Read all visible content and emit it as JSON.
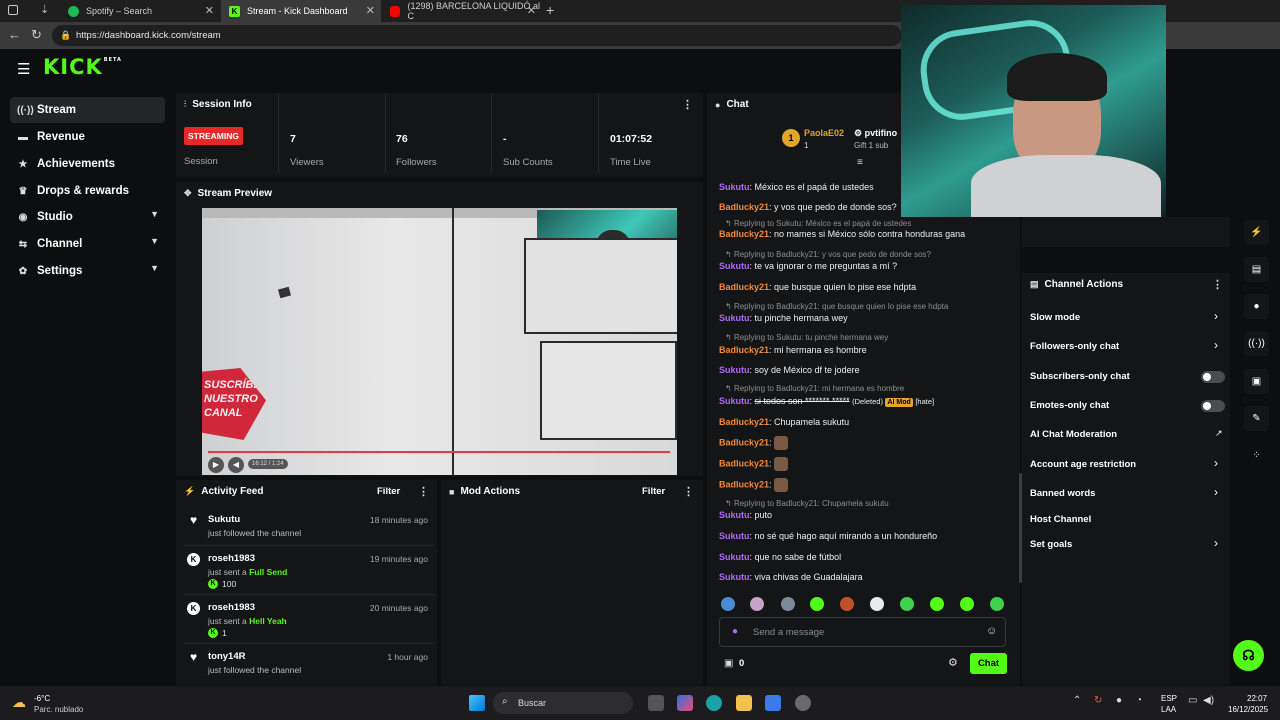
{
  "browser": {
    "tabs": [
      {
        "label": "Spotify – Search",
        "color": "#1db954"
      },
      {
        "label": "Stream - Kick Dashboard",
        "color": "#53fc18"
      },
      {
        "label": "(1298) BARCELONA LIQUIDÓ al C",
        "color": "#ff0000"
      }
    ],
    "url": "https://dashboard.kick.com/stream"
  },
  "logo": {
    "text": "KICK",
    "badge": "BETA"
  },
  "sidebar": {
    "items": [
      {
        "label": "Stream",
        "icon": "broadcast-icon"
      },
      {
        "label": "Revenue",
        "icon": "money-icon"
      },
      {
        "label": "Achievements",
        "icon": "star-icon"
      },
      {
        "label": "Drops & rewards",
        "icon": "gift-icon"
      },
      {
        "label": "Studio",
        "icon": "video-icon"
      },
      {
        "label": "Channel",
        "icon": "user-icon"
      },
      {
        "label": "Settings",
        "icon": "gear-icon"
      }
    ]
  },
  "session": {
    "title": "Session Info",
    "status": "STREAMING",
    "status_label": "Session",
    "stats": [
      {
        "value": "7",
        "label": "Viewers"
      },
      {
        "value": "76",
        "label": "Followers"
      },
      {
        "value": "-",
        "label": "Sub Counts"
      },
      {
        "value": "01:07:52",
        "label": "Time Live"
      }
    ]
  },
  "preview": {
    "title": "Stream Preview",
    "overlay_text": "SUSCRÍBETE NUESTRO CANAL",
    "time": "16:12 / 1:24"
  },
  "activity": {
    "title": "Activity Feed",
    "filter": "Filter",
    "items": [
      {
        "name": "Sukutu",
        "time": "18 minutes ago",
        "desc": "just followed the channel",
        "gift": "",
        "amount": ""
      },
      {
        "name": "roseh1983",
        "time": "19 minutes ago",
        "desc": "just sent a ",
        "gift": "Full Send",
        "amount": "100"
      },
      {
        "name": "roseh1983",
        "time": "20 minutes ago",
        "desc": "just sent a ",
        "gift": "Hell Yeah",
        "amount": "1"
      },
      {
        "name": "tony14R",
        "time": "1 hour ago",
        "desc": "just followed the channel",
        "gift": "",
        "amount": ""
      }
    ]
  },
  "mod_actions": {
    "title": "Mod Actions",
    "filter": "Filter"
  },
  "chat": {
    "title": "Chat",
    "pinned": {
      "user": "PaolaE02",
      "count": "1",
      "other_user": "pvtifino",
      "gift_text": "Gift 1 sub"
    },
    "messages": [
      {
        "reply": "",
        "user": "Sukutu",
        "color": "purple",
        "text": "México es el papá de ustedes"
      },
      {
        "reply": "",
        "user": "Badlucky21",
        "color": "orange",
        "text": "y vos que pedo de donde sos?"
      },
      {
        "reply": "Replying to Sukutu: México es el papá de ustedes",
        "user": "Badlucky21",
        "color": "orange",
        "text": "no mames si México sólo contra honduras gana"
      },
      {
        "reply": "Replying to Badlucky21: y vos que pedo de donde sos?",
        "user": "Sukutu",
        "color": "purple",
        "text": "te va ignorar o me preguntas a mí ?"
      },
      {
        "reply": "",
        "user": "Badlucky21",
        "color": "orange",
        "text": "que busque quien lo pise ese hdpta"
      },
      {
        "reply": "Replying to Badlucky21: que busque quien lo pise ese hdpta",
        "user": "Sukutu",
        "color": "purple",
        "text": "tu pinche hermana wey"
      },
      {
        "reply": "Replying to Sukutu: tu pinche hermana wey",
        "user": "Badlucky21",
        "color": "orange",
        "text": "mi hermana es hombre"
      },
      {
        "reply": "",
        "user": "Sukutu",
        "color": "purple",
        "text": "soy de México df te jodere"
      },
      {
        "reply": "Replying to Badlucky21: mi hermana es hombre",
        "user": "Sukutu",
        "color": "purple",
        "text": "si todos son ******* *****",
        "deleted": "(Deleted)",
        "mod": "AI Mod",
        "hate": "[hate]"
      },
      {
        "reply": "",
        "user": "Badlucky21",
        "color": "orange",
        "text": "Chupamela sukutu"
      },
      {
        "reply": "",
        "user": "Badlucky21",
        "color": "orange",
        "text": ""
      },
      {
        "reply": "",
        "user": "Badlucky21",
        "color": "orange",
        "text": ""
      },
      {
        "reply": "",
        "user": "Badlucky21",
        "color": "orange",
        "text": ""
      },
      {
        "reply": "Replying to Badlucky21: Chupamela sukutu",
        "user": "Sukutu",
        "color": "purple",
        "text": "puto"
      },
      {
        "reply": "",
        "user": "Sukutu",
        "color": "purple",
        "text": "no sé qué hago aquí mirando a un hondureño"
      },
      {
        "reply": "",
        "user": "Sukutu",
        "color": "purple",
        "text": "que no sabe de fútbol"
      },
      {
        "reply": "",
        "user": "Sukutu",
        "color": "purple",
        "text": "viva chivas de Guadalajara"
      }
    ],
    "placeholder": "Send a message",
    "points": "0",
    "send_label": "Chat"
  },
  "channel_actions": {
    "title": "Channel Actions",
    "items": [
      {
        "label": "Slow mode",
        "control": "chevron"
      },
      {
        "label": "Followers-only chat",
        "control": "chevron"
      },
      {
        "label": "Subscribers-only chat",
        "control": "toggle"
      },
      {
        "label": "Emotes-only chat",
        "control": "toggle"
      },
      {
        "label": "AI Chat Moderation",
        "control": "external"
      },
      {
        "label": "Account age restriction",
        "control": "chevron"
      },
      {
        "label": "Banned words",
        "control": "chevron"
      },
      {
        "label": "Host Channel",
        "control": "none"
      },
      {
        "label": "Set goals",
        "control": "chevron"
      }
    ]
  },
  "taskbar": {
    "weather_temp": "-6°C",
    "weather_desc": "Parc. nublado",
    "search": "Buscar",
    "lang": "ESP",
    "lang2": "LAA",
    "time": "22:07",
    "date": "16/12/2025"
  }
}
